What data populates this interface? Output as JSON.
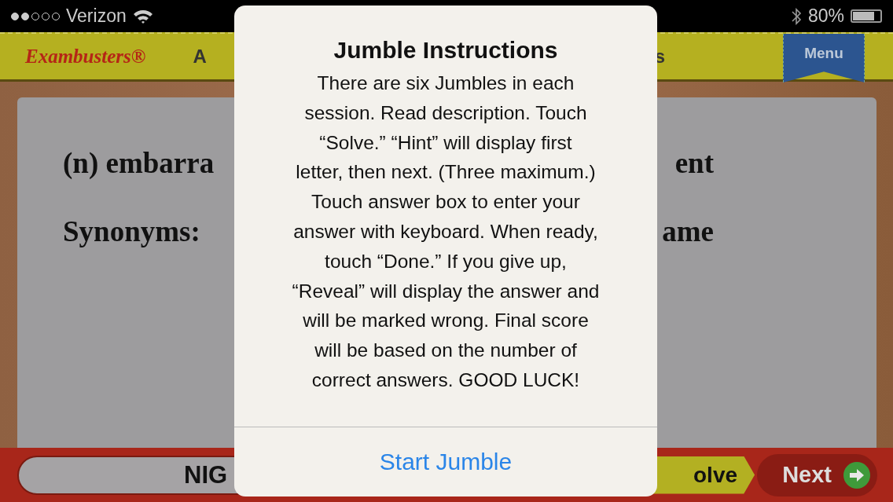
{
  "status_bar": {
    "carrier": "Verizon",
    "battery_text": "80%",
    "battery": {
      "level": 0.8
    }
  },
  "header": {
    "logo": "Exambusters®",
    "title_left": "A",
    "title_right": "s",
    "menu_button": "Menu"
  },
  "card": {
    "lines": [
      {
        "left": "(n) embarra",
        "right": "ent"
      },
      {
        "left": "Synonyms:",
        "right": "ame"
      }
    ]
  },
  "bottom_bar": {
    "answer_field": {
      "value": "NIG"
    },
    "solve_button": "olve",
    "next_button": "Next"
  },
  "dialog": {
    "title": "Jumble Instructions",
    "message": "There are six Jumbles in each\nsession. Read description. Touch\n“Solve.” “Hint” will display first\nletter, then next. (Three maximum.)\nTouch answer box to enter your\nanswer with keyboard. When ready,\ntouch “Done.” If you give up,\n“Reveal” will display the answer and\nwill be marked wrong. Final score\nwill be based on the number of\ncorrect answers. GOOD LUCK!",
    "button": "Start Jumble"
  }
}
